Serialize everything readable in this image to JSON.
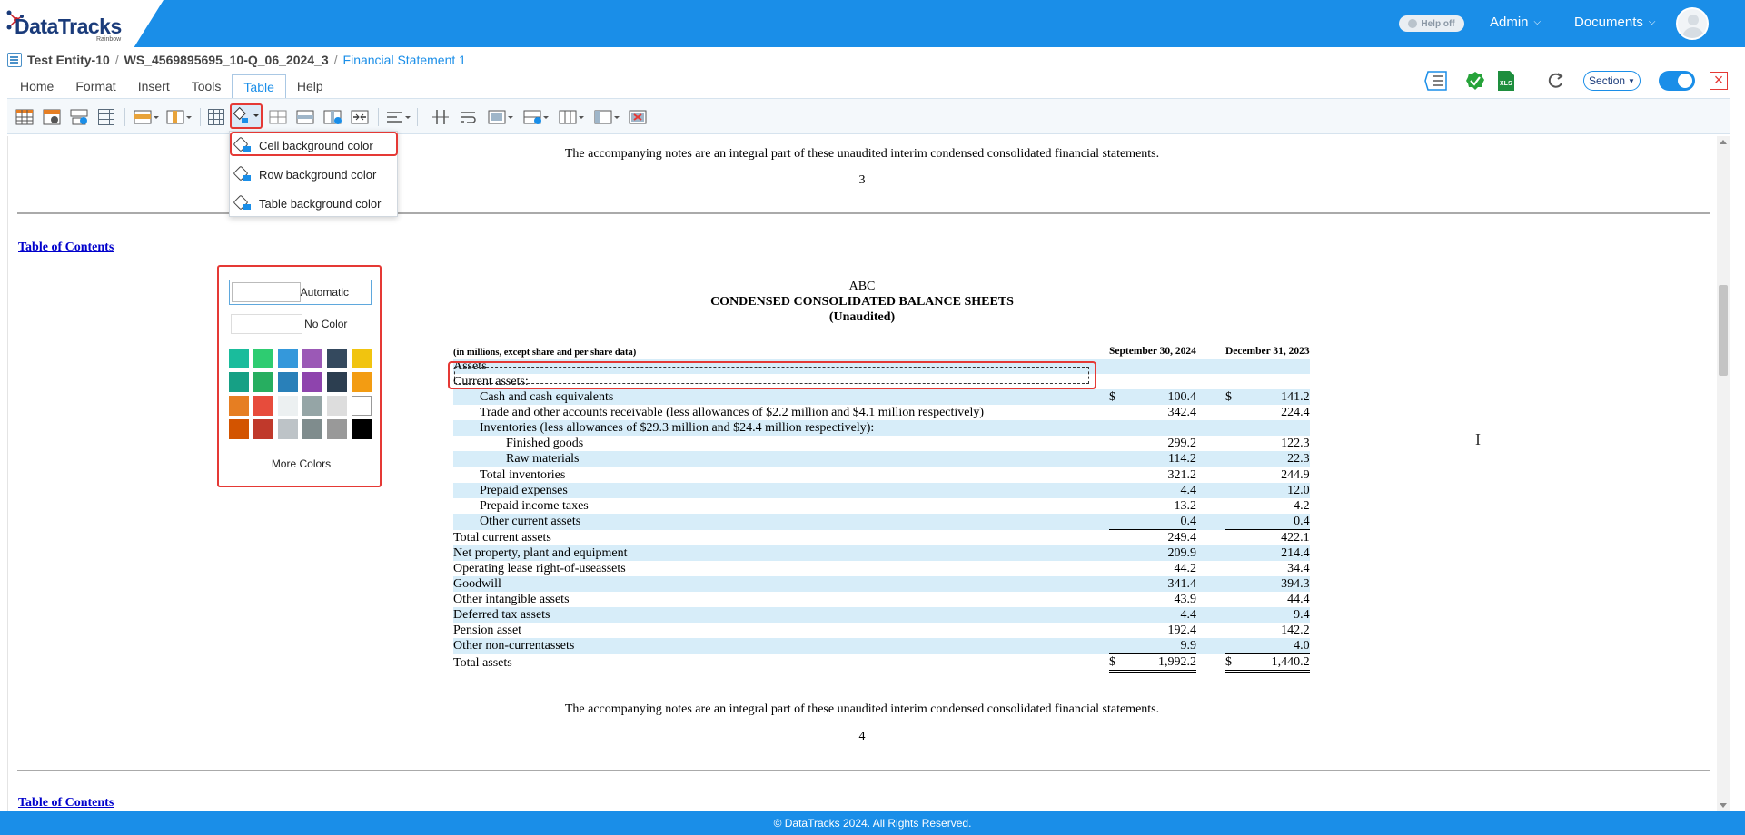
{
  "header": {
    "logo_text": "DataTracks",
    "logo_subtext": "Rainbow",
    "help_toggle": "Help off",
    "admin_label": "Admin",
    "documents_label": "Documents"
  },
  "breadcrumb": {
    "entity": "Test Entity-10",
    "workspace": "WS_4569895695_10-Q_06_2024_3",
    "separator": "/",
    "statement": "Financial Statement 1"
  },
  "menu": {
    "tabs": [
      "Home",
      "Format",
      "Insert",
      "Tools",
      "Table",
      "Help"
    ],
    "active": "Table"
  },
  "right_tools": {
    "section_label": "Section"
  },
  "toolbar_icons": [
    "insert-table-icon",
    "table-properties-icon",
    "insert-caption-icon",
    "grid-icon",
    "row-options-icon",
    "column-options-icon",
    "table-grid-icon",
    "background-color-icon",
    "insert-row-above-icon",
    "insert-row-below-icon",
    "insert-column-icon",
    "merge-cells-icon",
    "align-icon",
    "split-column-icon",
    "wrap-icon",
    "cell-options-icon",
    "row-height-icon",
    "column-width-icon",
    "table-layout-icon",
    "delete-table-icon"
  ],
  "dropdown": {
    "items": [
      "Cell background color",
      "Row background color",
      "Table background color"
    ],
    "highlighted": "Cell background color"
  },
  "color_picker": {
    "automatic_label": "Automatic",
    "no_color_label": "No Color",
    "more_colors_label": "More Colors",
    "swatches": [
      "#1abc9c",
      "#2ecc71",
      "#3498db",
      "#9b59b6",
      "#34495e",
      "#f1c40f",
      "#16a085",
      "#27ae60",
      "#2980b9",
      "#8e44ad",
      "#2c3e50",
      "#f39c12",
      "#e67e22",
      "#e74c3c",
      "#ecf0f1",
      "#95a5a6",
      "#dddddd",
      "#ffffff",
      "#d35400",
      "#c0392b",
      "#bdc3c7",
      "#7f8c8d",
      "#999999",
      "#000000"
    ]
  },
  "document": {
    "note_top": "The accompanying notes are an integral part of these unaudited interim condensed consolidated financial statements.",
    "page_top": "3",
    "toc_label": "Table of Contents",
    "company": "ABC",
    "title": "CONDENSED CONSOLIDATED BALANCE SHEETS",
    "subtitle": "(Unaudited)",
    "unit_note": "(in millions, except share and per share data)",
    "col1_header": "September 30, 2024",
    "col2_header": "December 31, 2023",
    "rows": [
      {
        "label": "Assets",
        "indent": 0,
        "v1": "",
        "v2": "",
        "cur": false,
        "shade": true
      },
      {
        "label": "Current assets:",
        "indent": 0,
        "v1": "",
        "v2": "",
        "cur": false,
        "shade": false
      },
      {
        "label": "Cash and cash equivalents",
        "indent": 1,
        "v1": "100.4",
        "v2": "141.2",
        "cur": true,
        "shade": true
      },
      {
        "label": "Trade and other accounts receivable (less allowances of $2.2 million and $4.1 million respectively)",
        "indent": 1,
        "v1": "342.4",
        "v2": "224.4",
        "cur": false,
        "shade": false
      },
      {
        "label": "Inventories (less allowances of $29.3 million and $24.4 million respectively):",
        "indent": 1,
        "v1": "",
        "v2": "",
        "cur": false,
        "shade": true
      },
      {
        "label": "Finished goods",
        "indent": 2,
        "v1": "299.2",
        "v2": "122.3",
        "cur": false,
        "shade": false
      },
      {
        "label": "Raw materials",
        "indent": 2,
        "v1": "114.2",
        "v2": "22.3",
        "cur": false,
        "shade": true,
        "ul": true
      },
      {
        "label": "Total inventories",
        "indent": 1,
        "v1": "321.2",
        "v2": "244.9",
        "cur": false,
        "shade": false
      },
      {
        "label": "Prepaid expenses",
        "indent": 1,
        "v1": "4.4",
        "v2": "12.0",
        "cur": false,
        "shade": true
      },
      {
        "label": "Prepaid income taxes",
        "indent": 1,
        "v1": "13.2",
        "v2": "4.2",
        "cur": false,
        "shade": false
      },
      {
        "label": "Other current assets",
        "indent": 1,
        "v1": "0.4",
        "v2": "0.4",
        "cur": false,
        "shade": true,
        "ul": true
      },
      {
        "label": "Total current assets",
        "indent": 0,
        "v1": "249.4",
        "v2": "422.1",
        "cur": false,
        "shade": false
      },
      {
        "label": "Net property, plant and equipment",
        "indent": 0,
        "v1": "209.9",
        "v2": "214.4",
        "cur": false,
        "shade": true
      },
      {
        "label": "Operating lease right-of-useassets",
        "indent": 0,
        "v1": "44.2",
        "v2": "34.4",
        "cur": false,
        "shade": false
      },
      {
        "label": "Goodwill",
        "indent": 0,
        "v1": "341.4",
        "v2": "394.3",
        "cur": false,
        "shade": true
      },
      {
        "label": "Other intangible assets",
        "indent": 0,
        "v1": "43.9",
        "v2": "44.4",
        "cur": false,
        "shade": false
      },
      {
        "label": "Deferred tax assets",
        "indent": 0,
        "v1": "4.4",
        "v2": "9.4",
        "cur": false,
        "shade": true
      },
      {
        "label": "Pension asset",
        "indent": 0,
        "v1": "192.4",
        "v2": "142.2",
        "cur": false,
        "shade": false
      },
      {
        "label": "Other non-currentassets",
        "indent": 0,
        "v1": "9.9",
        "v2": "4.0",
        "cur": false,
        "shade": true,
        "ul": true
      },
      {
        "label": "Total assets",
        "indent": 0,
        "v1": "1,992.2",
        "v2": "1,440.2",
        "cur": true,
        "shade": false,
        "dul": true
      }
    ],
    "currency_symbol": "$",
    "note_bottom": "The accompanying notes are an integral part of these unaudited interim condensed consolidated financial statements.",
    "page_bottom": "4",
    "toc_label_bottom": "Table of Contents"
  },
  "footer": {
    "text": "© DataTracks 2024. All Rights Reserved."
  }
}
